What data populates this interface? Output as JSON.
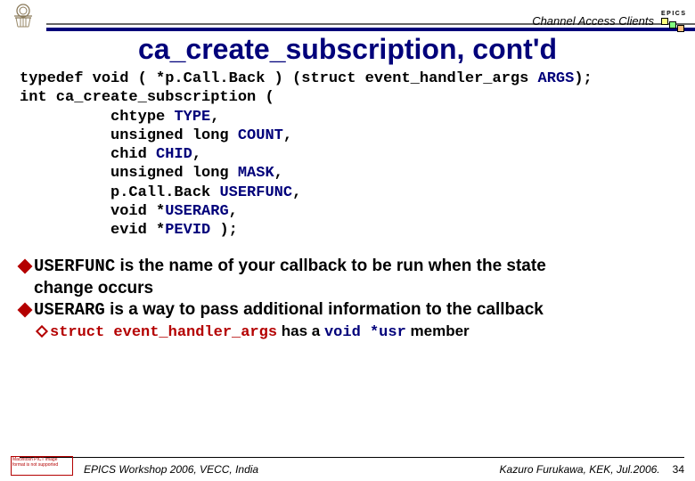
{
  "header": {
    "channel_label": "Channel Access Clients",
    "epics_label": "EPICS"
  },
  "title": "ca_create_subscription, cont'd",
  "code": {
    "line1_a": "typedef void ( *p.Call.Back ) (struct event_handler_args ",
    "line1_b": "ARGS",
    "line1_c": ");",
    "line2": "int ca_create_subscription (",
    "line3_a": "          chtype ",
    "line3_b": "TYPE",
    "line3_c": ",",
    "line4_a": "          unsigned long ",
    "line4_b": "COUNT",
    "line4_c": ",",
    "line5_a": "          chid ",
    "line5_b": "CHID",
    "line5_c": ",",
    "line6_a": "          unsigned long ",
    "line6_b": "MASK",
    "line6_c": ",",
    "line7_a": "          p.Call.Back ",
    "line7_b": "USERFUNC",
    "line7_c": ",",
    "line8_a": "          void *",
    "line8_b": "USERARG",
    "line8_c": ",",
    "line9_a": "          evid *",
    "line9_b": "PEVID",
    "line9_c": " );"
  },
  "bullets": {
    "b1_code": "USERFUNC",
    "b1_text_a": " is the name of your callback to be run when the state",
    "b1_text_b": "change occurs",
    "b2_code": "USERARG",
    "b2_text": " is a way to pass additional information to the callback",
    "sub_code1": "struct event_handler_args",
    "sub_text1": " has a ",
    "sub_code2": "void *usr",
    "sub_text2": " member"
  },
  "footer": {
    "left": "EPICS Workshop 2006, VECC, India",
    "right": "Kazuro Furukawa, KEK, Jul.2006.",
    "page": "34",
    "error_box": "Macintosh PICT image format is not supported"
  }
}
